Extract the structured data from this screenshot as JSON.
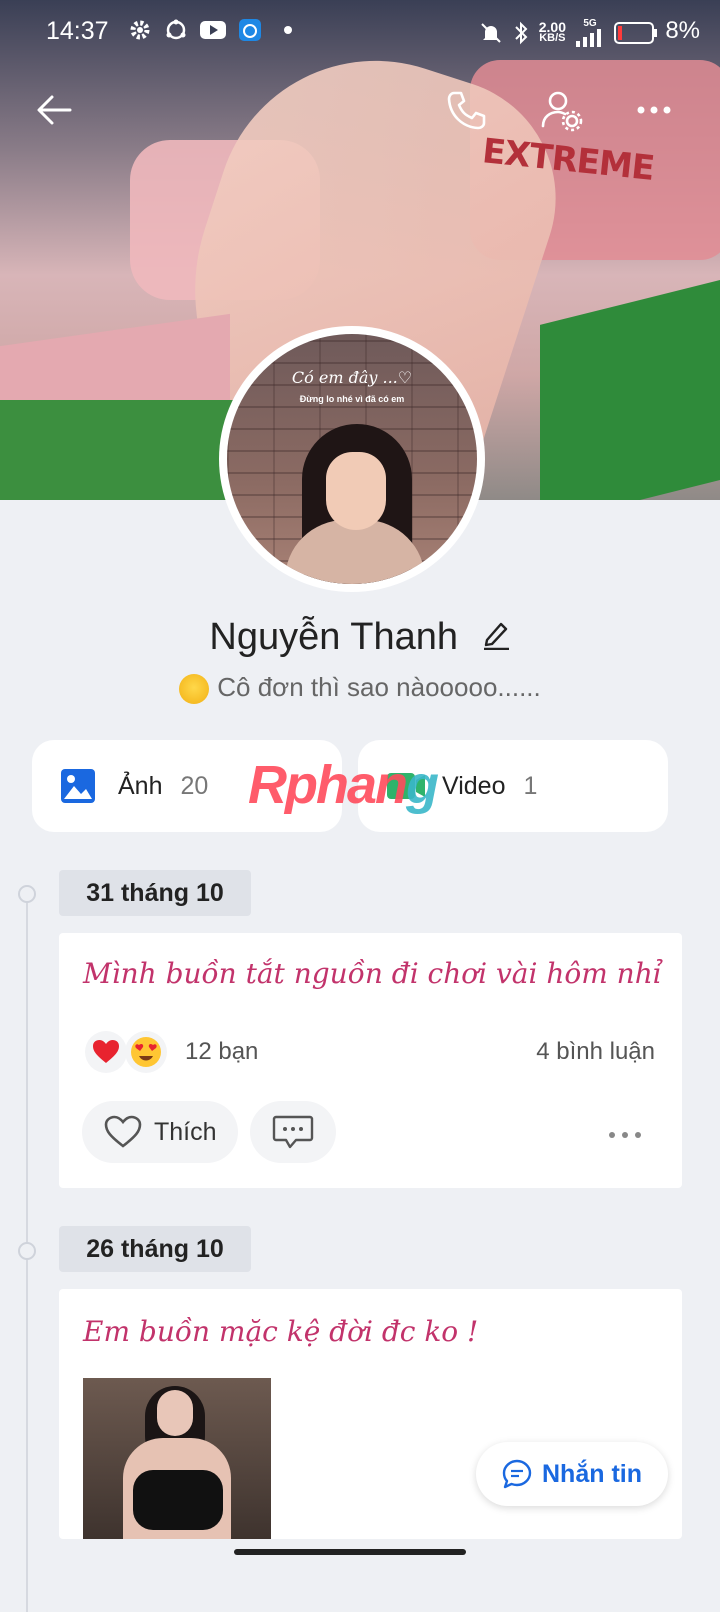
{
  "status_bar": {
    "time": "14:37",
    "net_speed_value": "2.00",
    "net_speed_unit": "KB/S",
    "network": "5G",
    "battery": "8%"
  },
  "profile": {
    "name": "Nguyễn Thanh",
    "status": "Cô đơn thì sao nàooooo......",
    "avatar_caption_1": "Có em đây ...♡",
    "avatar_caption_2": "Đừng lo nhé vì đã có em",
    "cover_text": "EXTREME"
  },
  "media": {
    "photos_label": "Ảnh",
    "photos_count": "20",
    "videos_label": "Video",
    "videos_count": "1"
  },
  "watermark": {
    "part1": "Rphan",
    "part2": "g"
  },
  "timeline": [
    {
      "date": "31 tháng 10",
      "text": "Mình buồn tắt nguồn đi chơi vài hôm nhỉ",
      "reactions_count": "12 bạn",
      "comments": "4 bình luận",
      "like_label": "Thích"
    },
    {
      "date": "26 tháng 10",
      "text": "Em buồn mặc kệ đời đc ko !"
    }
  ],
  "message_button": "Nhắn tin",
  "colors": {
    "accent": "#1a68e0",
    "post_text": "#c2336b",
    "background": "#eef0f4"
  }
}
